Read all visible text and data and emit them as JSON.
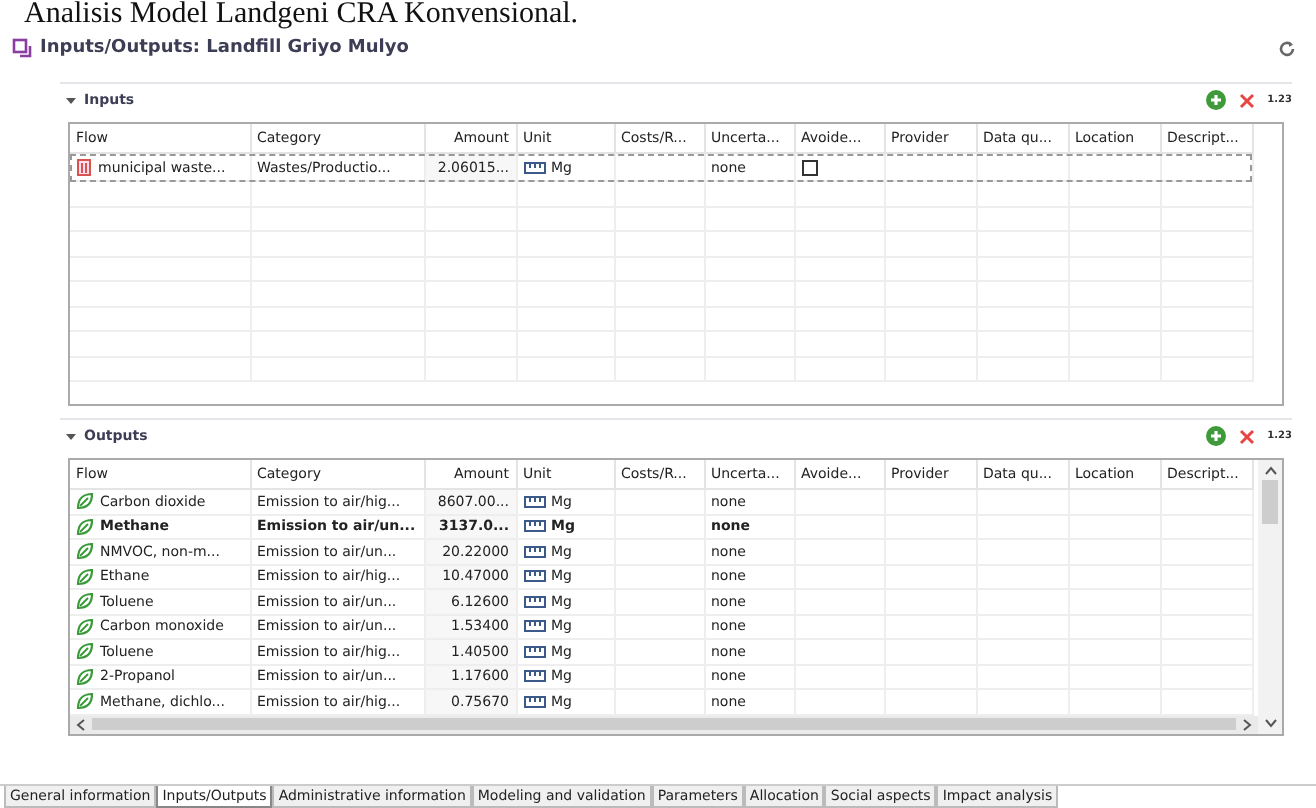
{
  "document_heading": "Analisis Model Landgeni CRA Konvensional.",
  "editor": {
    "title": "Inputs/Outputs: Landfill Griyo Mulyo"
  },
  "sections": [
    {
      "title": "Inputs",
      "expanded": true,
      "actions": [
        "1.23"
      ],
      "columns": [
        "Flow",
        "Category",
        "Amount",
        "Unit",
        "Costs/R...",
        "Uncerta...",
        "Avoide...",
        "Provider",
        "Data qu...",
        "Location",
        "Descript..."
      ],
      "rows": [
        {
          "kind": "waste",
          "flow": "municipal waste...",
          "category": "Wastes/Productio...",
          "amount": "2.06015...",
          "unit": "Mg",
          "uncertainty": "none",
          "avoided": false,
          "reference": false,
          "selected": true
        }
      ]
    },
    {
      "title": "Outputs",
      "expanded": true,
      "actions": [
        "1.23"
      ],
      "columns": [
        "Flow",
        "Category",
        "Amount",
        "Unit",
        "Costs/R...",
        "Uncerta...",
        "Avoide...",
        "Provider",
        "Data qu...",
        "Location",
        "Descript..."
      ],
      "rows": [
        {
          "kind": "emission",
          "flow": "Carbon dioxide",
          "category": "Emission to air/hig...",
          "amount": "8607.00...",
          "unit": "Mg",
          "uncertainty": "none",
          "reference": false,
          "selected": false
        },
        {
          "kind": "emission",
          "flow": "Methane",
          "category": "Emission to air/un...",
          "amount": "3137.0...",
          "unit": "Mg",
          "uncertainty": "none",
          "reference": true,
          "selected": false
        },
        {
          "kind": "emission",
          "flow": "NMVOC, non-m...",
          "category": "Emission to air/un...",
          "amount": "20.22000",
          "unit": "Mg",
          "uncertainty": "none",
          "reference": false,
          "selected": false
        },
        {
          "kind": "emission",
          "flow": "Ethane",
          "category": "Emission to air/hig...",
          "amount": "10.47000",
          "unit": "Mg",
          "uncertainty": "none",
          "reference": false,
          "selected": false
        },
        {
          "kind": "emission",
          "flow": "Toluene",
          "category": "Emission to air/un...",
          "amount": "6.12600",
          "unit": "Mg",
          "uncertainty": "none",
          "reference": false,
          "selected": false
        },
        {
          "kind": "emission",
          "flow": "Carbon monoxide",
          "category": "Emission to air/un...",
          "amount": "1.53400",
          "unit": "Mg",
          "uncertainty": "none",
          "reference": false,
          "selected": false
        },
        {
          "kind": "emission",
          "flow": "Toluene",
          "category": "Emission to air/hig...",
          "amount": "1.40500",
          "unit": "Mg",
          "uncertainty": "none",
          "reference": false,
          "selected": false
        },
        {
          "kind": "emission",
          "flow": "2-Propanol",
          "category": "Emission to air/un...",
          "amount": "1.17600",
          "unit": "Mg",
          "uncertainty": "none",
          "reference": false,
          "selected": false
        },
        {
          "kind": "emission",
          "flow": "Methane, dichlo...",
          "category": "Emission to air/hig...",
          "amount": "0.75670",
          "unit": "Mg",
          "uncertainty": "none",
          "reference": false,
          "selected": false
        }
      ]
    }
  ],
  "tabs": [
    {
      "label": "General information",
      "selected": false
    },
    {
      "label": "Inputs/Outputs",
      "selected": true
    },
    {
      "label": "Administrative information",
      "selected": false
    },
    {
      "label": "Modeling and validation",
      "selected": false
    },
    {
      "label": "Parameters",
      "selected": false
    },
    {
      "label": "Allocation",
      "selected": false
    },
    {
      "label": "Social aspects",
      "selected": false
    },
    {
      "label": "Impact analysis",
      "selected": false
    }
  ]
}
